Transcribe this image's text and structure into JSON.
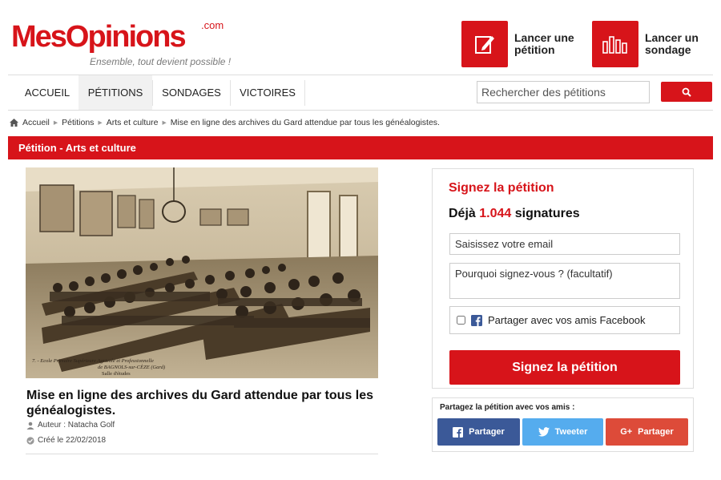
{
  "logo": {
    "main": "MesOpinions",
    "suffix": ".com",
    "tagline": "Ensemble, tout devient possible !"
  },
  "header_buttons": {
    "petition": "Lancer une pétition",
    "sondage": "Lancer un sondage"
  },
  "nav": {
    "items": [
      {
        "label": "ACCUEIL"
      },
      {
        "label": "PÉTITIONS"
      },
      {
        "label": "SONDAGES"
      },
      {
        "label": "VICTOIRES"
      }
    ],
    "active": "PÉTITIONS"
  },
  "search": {
    "placeholder": "Rechercher des pétitions"
  },
  "breadcrumb": [
    "Accueil",
    "Pétitions",
    "Arts et culture",
    "Mise en ligne des archives du Gard attendue par tous les généalogistes."
  ],
  "category_bar": "Pétition - Arts et culture",
  "photo": {
    "caption_line1": "7. - Ecole Primaire Supérieure Agricole et Professionnelle",
    "caption_line2": "de BAGNOLS-sur-CÈZE (Gard)",
    "caption_line3": "Salle d'études"
  },
  "petition": {
    "title": "Mise en ligne des archives du Gard attendue par tous les généalogistes.",
    "author": "Auteur : Natacha Golf",
    "created": "Créé le 22/02/2018"
  },
  "sign": {
    "title": "Signez la pétition",
    "count_prefix": "Déjà",
    "count": "1.044",
    "count_suffix": "signatures",
    "email_placeholder": "Saisissez votre email",
    "reason_placeholder": "Pourquoi signez-vous ? (facultatif)",
    "facebook_share": "Partager avec vos amis Facebook",
    "button": "Signez la pétition"
  },
  "share": {
    "title": "Partagez la pétition avec vos amis :",
    "facebook": "Partager",
    "twitter": "Tweeter",
    "google": "Partager"
  },
  "colors": {
    "brand_red": "#d7141a",
    "facebook": "#3b5998",
    "twitter": "#55acee",
    "google": "#dd4b39"
  }
}
